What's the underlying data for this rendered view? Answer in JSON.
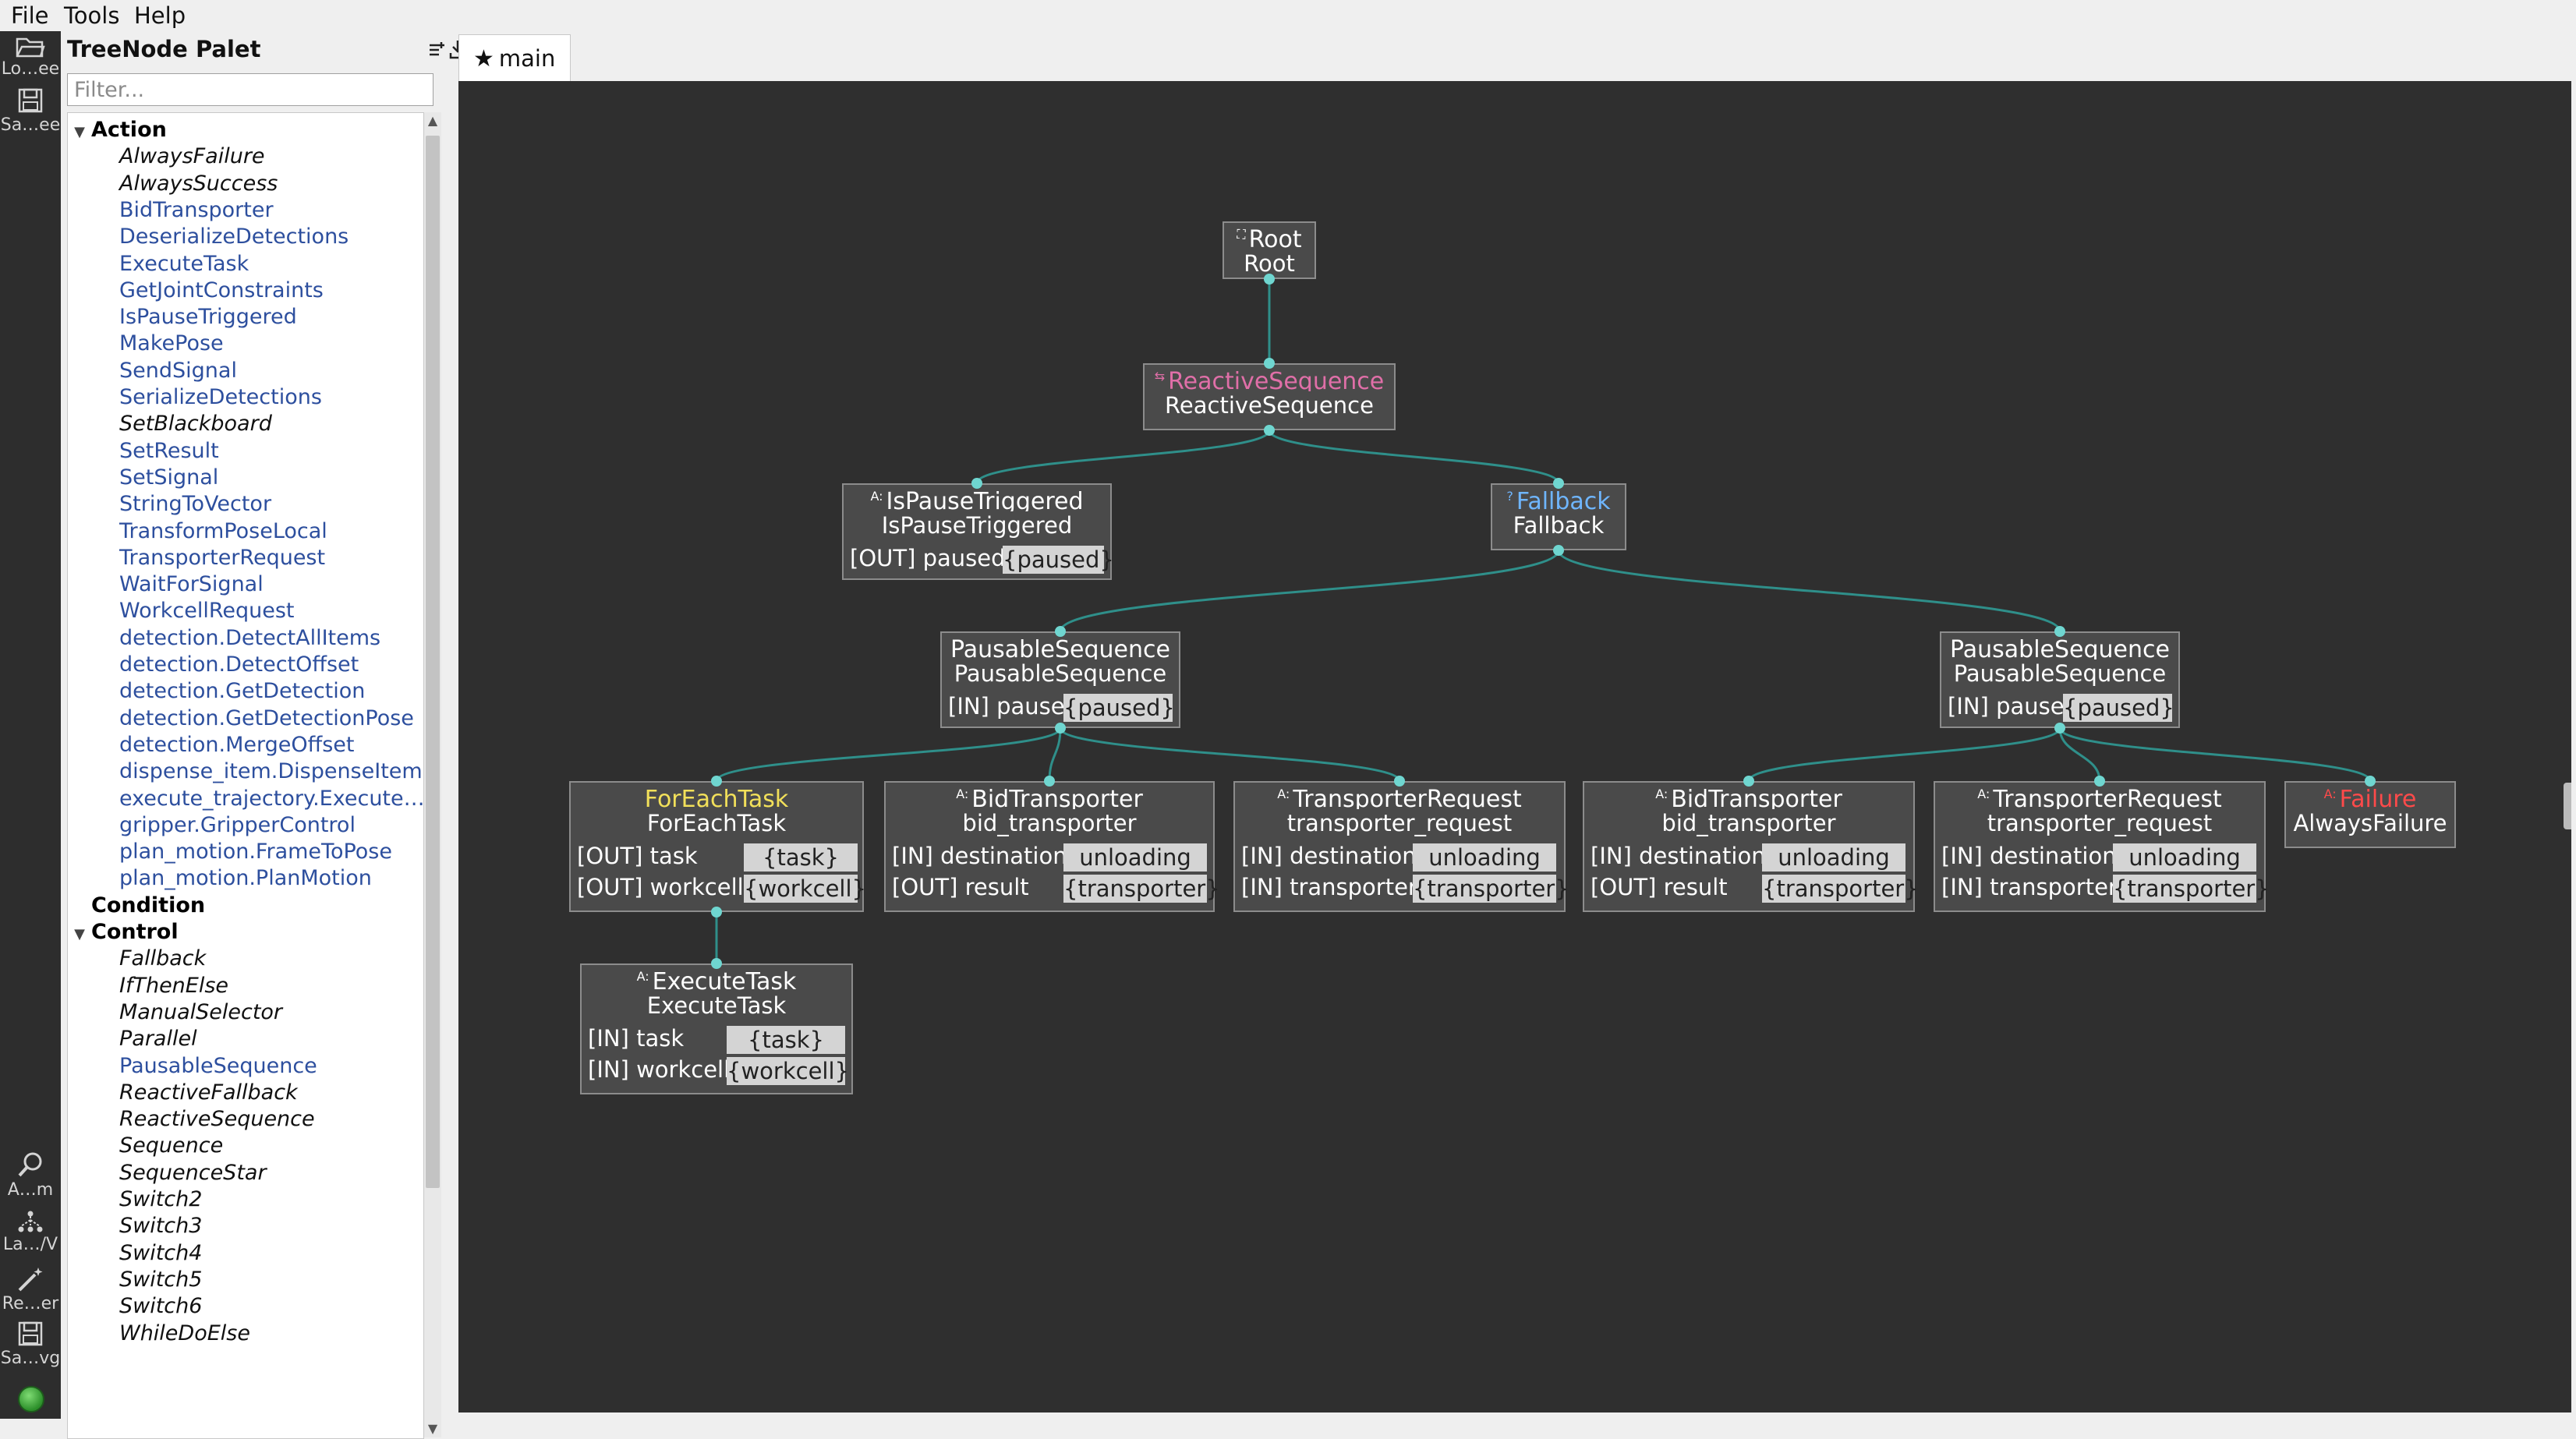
{
  "menu": {
    "items": [
      "File",
      "Tools",
      "Help"
    ]
  },
  "toolbar": {
    "load_label": "Lo…ee",
    "save_label": "Sa…ee",
    "zoom_label": "A…m",
    "layout_label": "La…/V",
    "reorder_label": "Re…er",
    "save_svg_label": "Sa…vg"
  },
  "palette": {
    "title": "TreeNode Palet",
    "filter_placeholder": "Filter...",
    "categories": [
      {
        "name": "Action",
        "items": [
          {
            "label": "AlwaysFailure",
            "builtin": true
          },
          {
            "label": "AlwaysSuccess",
            "builtin": true
          },
          {
            "label": "BidTransporter",
            "builtin": false
          },
          {
            "label": "DeserializeDetections",
            "builtin": false
          },
          {
            "label": "ExecuteTask",
            "builtin": false
          },
          {
            "label": "GetJointConstraints",
            "builtin": false
          },
          {
            "label": "IsPauseTriggered",
            "builtin": false
          },
          {
            "label": "MakePose",
            "builtin": false
          },
          {
            "label": "SendSignal",
            "builtin": false
          },
          {
            "label": "SerializeDetections",
            "builtin": false
          },
          {
            "label": "SetBlackboard",
            "builtin": true
          },
          {
            "label": "SetResult",
            "builtin": false
          },
          {
            "label": "SetSignal",
            "builtin": false
          },
          {
            "label": "StringToVector",
            "builtin": false
          },
          {
            "label": "TransformPoseLocal",
            "builtin": false
          },
          {
            "label": "TransporterRequest",
            "builtin": false
          },
          {
            "label": "WaitForSignal",
            "builtin": false
          },
          {
            "label": "WorkcellRequest",
            "builtin": false
          },
          {
            "label": "detection.DetectAllItems",
            "builtin": false
          },
          {
            "label": "detection.DetectOffset",
            "builtin": false
          },
          {
            "label": "detection.GetDetection",
            "builtin": false
          },
          {
            "label": "detection.GetDetectionPose",
            "builtin": false
          },
          {
            "label": "detection.MergeOffset",
            "builtin": false
          },
          {
            "label": "dispense_item.DispenseItem",
            "builtin": false
          },
          {
            "label": "execute_trajectory.Execute…",
            "builtin": false
          },
          {
            "label": "gripper.GripperControl",
            "builtin": false
          },
          {
            "label": "plan_motion.FrameToPose",
            "builtin": false
          },
          {
            "label": "plan_motion.PlanMotion",
            "builtin": false
          }
        ]
      },
      {
        "name": "Condition",
        "items": []
      },
      {
        "name": "Control",
        "items": [
          {
            "label": "Fallback",
            "builtin": true
          },
          {
            "label": "IfThenElse",
            "builtin": true
          },
          {
            "label": "ManualSelector",
            "builtin": true
          },
          {
            "label": "Parallel",
            "builtin": true
          },
          {
            "label": "PausableSequence",
            "builtin": false
          },
          {
            "label": "ReactiveFallback",
            "builtin": true
          },
          {
            "label": "ReactiveSequence",
            "builtin": true
          },
          {
            "label": "Sequence",
            "builtin": true
          },
          {
            "label": "SequenceStar",
            "builtin": true
          },
          {
            "label": "Switch2",
            "builtin": true
          },
          {
            "label": "Switch3",
            "builtin": true
          },
          {
            "label": "Switch4",
            "builtin": true
          },
          {
            "label": "Switch5",
            "builtin": true
          },
          {
            "label": "Switch6",
            "builtin": true
          },
          {
            "label": "WhileDoElse",
            "builtin": true
          }
        ]
      }
    ]
  },
  "tab": {
    "label": "main",
    "icon": "star-icon"
  },
  "colors": {
    "canvas": "#2f2f2f",
    "node": "#4a4a4a",
    "edge": "#2f8f8a",
    "port_dot": "#6fd6d0",
    "control_pink": "#e06fa8",
    "control_blue": "#6fb6ff",
    "decorator_yellow": "#f2e05a",
    "failure_red": "#ff4a4a",
    "custom_item": "#2d4f9e"
  },
  "tree": {
    "nodes": [
      {
        "id": "root",
        "badge": "⛶",
        "type_label": "Root",
        "instance": "Root",
        "type_color": "#ffffff",
        "ports": []
      },
      {
        "id": "reactive_sequence",
        "badge": "⇆",
        "type_label": "ReactiveSequence",
        "instance": "ReactiveSequence",
        "type_color": "#e06fa8",
        "ports": []
      },
      {
        "id": "is_pause_triggered",
        "badge": "A:",
        "type_label": "IsPauseTriggered",
        "instance": "IsPauseTriggered",
        "type_color": "#ffffff",
        "ports": [
          {
            "label": "[OUT] paused",
            "value": "{paused}"
          }
        ]
      },
      {
        "id": "fallback",
        "badge": "?",
        "type_label": "Fallback",
        "instance": "Fallback",
        "type_color": "#6fb6ff",
        "ports": []
      },
      {
        "id": "pausable_sequence_1",
        "badge": "",
        "type_label": "PausableSequence",
        "instance": "PausableSequence",
        "type_color": "#ffffff",
        "ports": [
          {
            "label": "[IN] pause",
            "value": "{paused}"
          }
        ]
      },
      {
        "id": "pausable_sequence_2",
        "badge": "",
        "type_label": "PausableSequence",
        "instance": "PausableSequence",
        "type_color": "#ffffff",
        "ports": [
          {
            "label": "[IN] pause",
            "value": "{paused}"
          }
        ]
      },
      {
        "id": "for_each_task",
        "badge": "",
        "type_label": "ForEachTask",
        "instance": "ForEachTask",
        "type_color": "#f2e05a",
        "ports": [
          {
            "label": "[OUT] task",
            "value": "{task}"
          },
          {
            "label": "[OUT] workcell",
            "value": "{workcell}"
          }
        ]
      },
      {
        "id": "bid_transporter_1",
        "badge": "A:",
        "type_label": "BidTransporter",
        "instance": "bid_transporter",
        "type_color": "#ffffff",
        "ports": [
          {
            "label": "[IN] destination",
            "value": "unloading"
          },
          {
            "label": "[OUT] result",
            "value": "{transporter}"
          }
        ]
      },
      {
        "id": "transporter_request_1",
        "badge": "A:",
        "type_label": "TransporterRequest",
        "instance": "transporter_request",
        "type_color": "#ffffff",
        "ports": [
          {
            "label": "[IN] destination",
            "value": "unloading"
          },
          {
            "label": "[IN] transporter",
            "value": "{transporter}"
          }
        ]
      },
      {
        "id": "bid_transporter_2",
        "badge": "A:",
        "type_label": "BidTransporter",
        "instance": "bid_transporter",
        "type_color": "#ffffff",
        "ports": [
          {
            "label": "[IN] destination",
            "value": "unloading"
          },
          {
            "label": "[OUT] result",
            "value": "{transporter}"
          }
        ]
      },
      {
        "id": "transporter_request_2",
        "badge": "A:",
        "type_label": "TransporterRequest",
        "instance": "transporter_request",
        "type_color": "#ffffff",
        "ports": [
          {
            "label": "[IN] destination",
            "value": "unloading"
          },
          {
            "label": "[IN] transporter",
            "value": "{transporter}"
          }
        ]
      },
      {
        "id": "always_failure",
        "badge": "A:",
        "type_label": "Failure",
        "instance": "AlwaysFailure",
        "type_color": "#ff4a4a",
        "ports": []
      },
      {
        "id": "execute_task",
        "badge": "A:",
        "type_label": "ExecuteTask",
        "instance": "ExecuteTask",
        "type_color": "#ffffff",
        "ports": [
          {
            "label": "[IN] task",
            "value": "{task}"
          },
          {
            "label": "[IN] workcell",
            "value": "{workcell}"
          }
        ]
      }
    ],
    "edges": [
      [
        "root",
        "reactive_sequence"
      ],
      [
        "reactive_sequence",
        "is_pause_triggered"
      ],
      [
        "reactive_sequence",
        "fallback"
      ],
      [
        "fallback",
        "pausable_sequence_1"
      ],
      [
        "fallback",
        "pausable_sequence_2"
      ],
      [
        "pausable_sequence_1",
        "for_each_task"
      ],
      [
        "pausable_sequence_1",
        "bid_transporter_1"
      ],
      [
        "pausable_sequence_1",
        "transporter_request_1"
      ],
      [
        "pausable_sequence_2",
        "bid_transporter_2"
      ],
      [
        "pausable_sequence_2",
        "transporter_request_2"
      ],
      [
        "pausable_sequence_2",
        "always_failure"
      ],
      [
        "for_each_task",
        "execute_task"
      ]
    ]
  }
}
